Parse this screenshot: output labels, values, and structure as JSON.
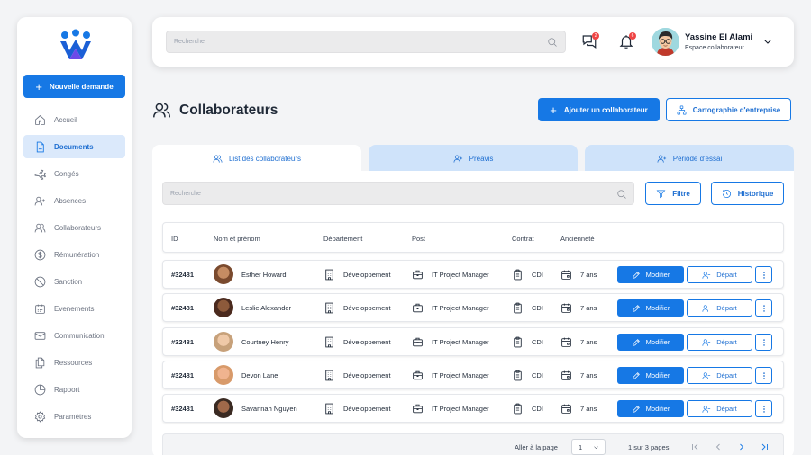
{
  "sidebar": {
    "new_request_label": "Nouvelle demande",
    "items": [
      {
        "label": "Accueil",
        "icon": "home-icon",
        "active": false
      },
      {
        "label": "Documents",
        "icon": "document-icon",
        "active": true
      },
      {
        "label": "Congés",
        "icon": "plane-icon",
        "active": false
      },
      {
        "label": "Absences",
        "icon": "user-plus-icon",
        "active": false
      },
      {
        "label": "Collaborateurs",
        "icon": "users-icon",
        "active": false
      },
      {
        "label": "Rémunération",
        "icon": "dollar-icon",
        "active": false
      },
      {
        "label": "Sanction",
        "icon": "ban-icon",
        "active": false
      },
      {
        "label": "Evenements",
        "icon": "calendar-icon",
        "active": false
      },
      {
        "label": "Communication",
        "icon": "mail-icon",
        "active": false
      },
      {
        "label": "Ressources",
        "icon": "files-icon",
        "active": false
      },
      {
        "label": "Rapport",
        "icon": "pie-chart-icon",
        "active": false
      },
      {
        "label": "Paramètres",
        "icon": "gear-icon",
        "active": false
      }
    ]
  },
  "header": {
    "search_placeholder": "Recherche",
    "messages_badge": "2",
    "notifications_badge": "6",
    "user_name": "Yassine El Alami",
    "user_role": "Espace collaborateur"
  },
  "page": {
    "title": "Collaborateurs",
    "add_button": "Ajouter un collaborateur",
    "map_button": "Cartographie d'entreprise"
  },
  "tabs": [
    {
      "label": "List des collaborateurs",
      "active": true
    },
    {
      "label": "Préavis",
      "active": false
    },
    {
      "label": "Periode d'essai",
      "active": false
    }
  ],
  "toolbar": {
    "search_placeholder": "Recherche",
    "filter_label": "Filtre",
    "history_label": "Historique"
  },
  "table": {
    "columns": [
      "ID",
      "Nom et prénom",
      "Département",
      "Post",
      "Contrat",
      "Ancienneté"
    ],
    "modify_label": "Modifier",
    "departure_label": "Départ",
    "rows": [
      {
        "id": "#32481",
        "name": "Esther Howard",
        "department": "Développement",
        "post": "IT Project Manager",
        "contract": "CDI",
        "seniority": "7 ans"
      },
      {
        "id": "#32481",
        "name": "Leslie Alexander",
        "department": "Développement",
        "post": "IT Project Manager",
        "contract": "CDI",
        "seniority": "7 ans"
      },
      {
        "id": "#32481",
        "name": "Courtney Henry",
        "department": "Développement",
        "post": "IT Project Manager",
        "contract": "CDI",
        "seniority": "7 ans"
      },
      {
        "id": "#32481",
        "name": "Devon Lane",
        "department": "Développement",
        "post": "IT Project Manager",
        "contract": "CDI",
        "seniority": "7 ans"
      },
      {
        "id": "#32481",
        "name": "Savannah Nguyen",
        "department": "Développement",
        "post": "IT Project Manager",
        "contract": "CDI",
        "seniority": "7 ans"
      }
    ]
  },
  "pagination": {
    "goto_label": "Aller à la page",
    "page_value": "1",
    "count_label": "1 sur 3 pages"
  },
  "colors": {
    "accent": "#1678e5",
    "accent_light": "#dbe9fb",
    "tab_inactive": "#cfe3fa",
    "badge": "#ef4444"
  }
}
